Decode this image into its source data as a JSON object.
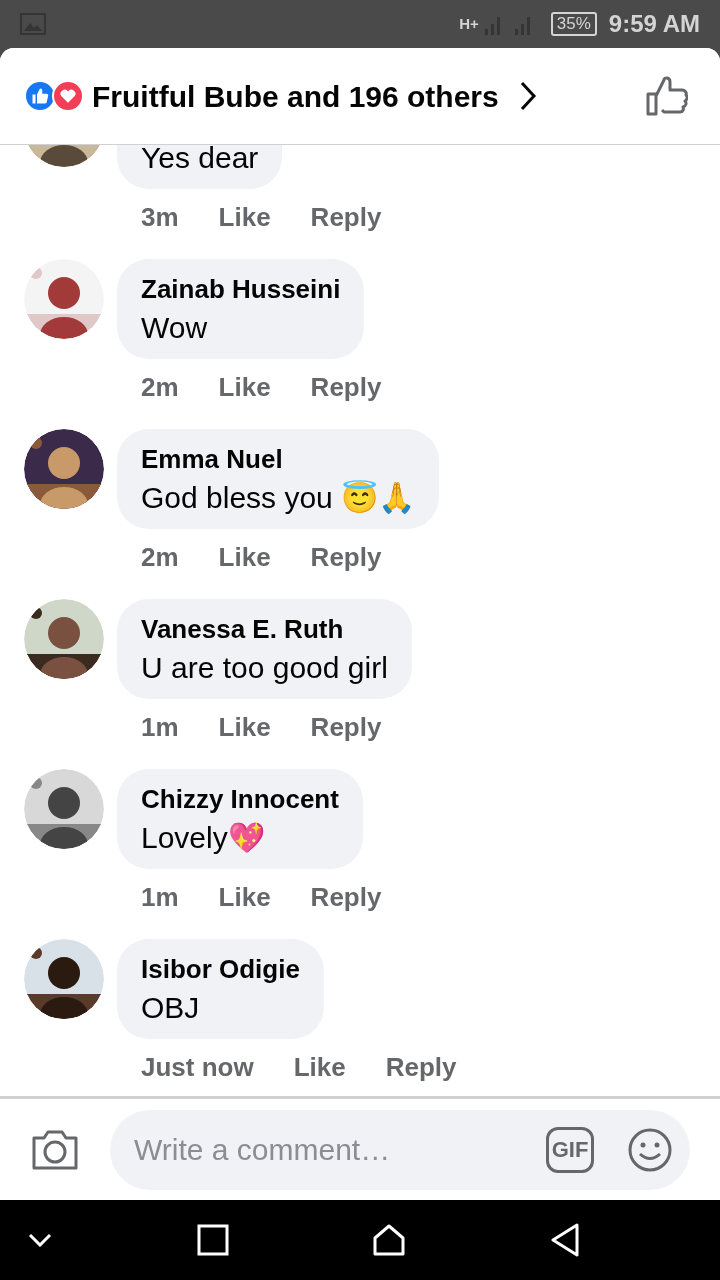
{
  "status_bar": {
    "network": "H+",
    "battery": "35%",
    "time": "9:59 AM"
  },
  "header": {
    "reactions_text": "Fruitful Bube and 196 others"
  },
  "comments": [
    {
      "text": "Yes dear",
      "time": "3m",
      "like": "Like",
      "reply": "Reply"
    },
    {
      "name": "Zainab Husseini",
      "text": "Wow",
      "time": "2m",
      "like": "Like",
      "reply": "Reply"
    },
    {
      "name": "Emma Nuel",
      "text": "God bless you 😇🙏",
      "time": "2m",
      "like": "Like",
      "reply": "Reply"
    },
    {
      "name": "Vanessa E. Ruth",
      "text": "U are too good girl",
      "time": "1m",
      "like": "Like",
      "reply": "Reply"
    },
    {
      "name": "Chizzy Innocent",
      "text": "Lovely💖",
      "time": "1m",
      "like": "Like",
      "reply": "Reply"
    },
    {
      "name": "Isibor Odigie",
      "text": "OBJ",
      "time": "Just now",
      "like": "Like",
      "reply": "Reply"
    }
  ],
  "composer": {
    "placeholder": "Write a comment…",
    "gif_label": "GIF"
  }
}
